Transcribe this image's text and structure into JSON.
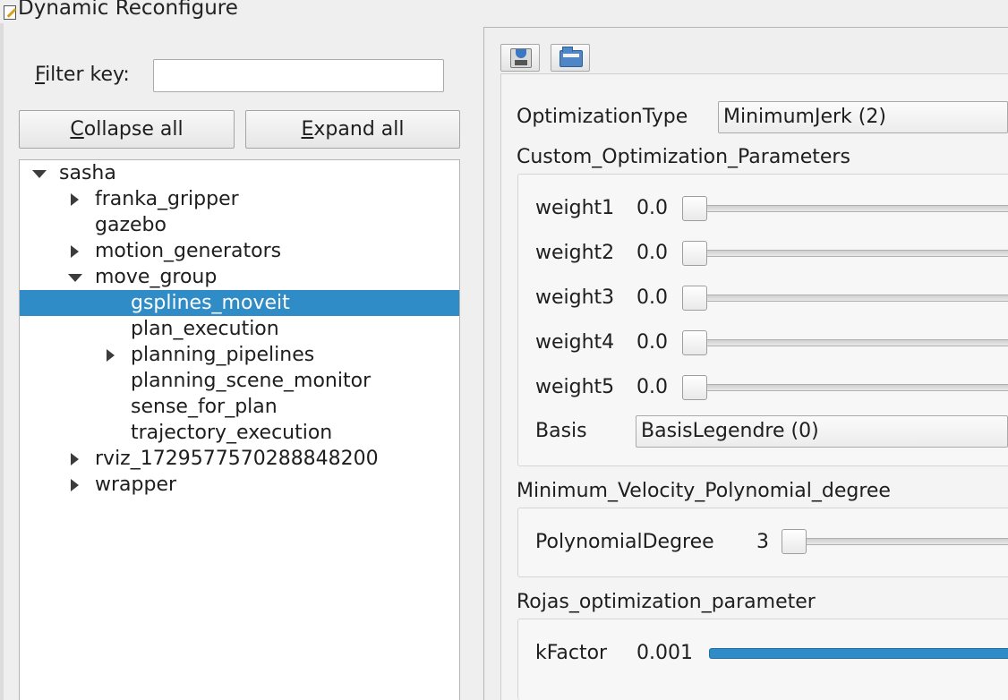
{
  "window": {
    "title": "Dynamic Reconfigure"
  },
  "filter": {
    "label": "Filter key:",
    "value": ""
  },
  "buttons": {
    "collapse_all": "Collapse all",
    "expand_all": "Expand all"
  },
  "tree": [
    {
      "label": "sasha",
      "expander": "expanded",
      "selected": false
    },
    {
      "label": "franka_gripper",
      "expander": "collapsed",
      "selected": false
    },
    {
      "label": "gazebo",
      "expander": "none",
      "selected": false
    },
    {
      "label": "motion_generators",
      "expander": "collapsed",
      "selected": false
    },
    {
      "label": "move_group",
      "expander": "expanded",
      "selected": false
    },
    {
      "label": "gsplines_moveit",
      "expander": "none",
      "selected": true
    },
    {
      "label": "plan_execution",
      "expander": "none",
      "selected": false
    },
    {
      "label": "planning_pipelines",
      "expander": "collapsed",
      "selected": false
    },
    {
      "label": "planning_scene_monitor",
      "expander": "none",
      "selected": false
    },
    {
      "label": "sense_for_plan",
      "expander": "none",
      "selected": false
    },
    {
      "label": "trajectory_execution",
      "expander": "none",
      "selected": false
    },
    {
      "label": "rviz_1729577570288848200",
      "expander": "collapsed",
      "selected": false
    },
    {
      "label": "wrapper",
      "expander": "collapsed",
      "selected": false
    }
  ],
  "toolbar": {
    "save_icon": "save-disk-icon",
    "open_icon": "open-folder-icon"
  },
  "params": {
    "optimization_type": {
      "label": "OptimizationType",
      "value": "MinimumJerk (2)"
    },
    "custom_group": {
      "title": "Custom_Optimization_Parameters",
      "weights": [
        {
          "label": "weight1",
          "value": "0.0",
          "level": 0
        },
        {
          "label": "weight2",
          "value": "0.0",
          "level": 0
        },
        {
          "label": "weight3",
          "value": "0.0",
          "level": 0
        },
        {
          "label": "weight4",
          "value": "0.0",
          "level": 0
        },
        {
          "label": "weight5",
          "value": "0.0",
          "level": 0
        }
      ],
      "basis": {
        "label": "Basis",
        "value": "BasisLegendre (0)"
      }
    },
    "min_velocity_group": {
      "title": "Minimum_Velocity_Polynomial_degree",
      "degree": {
        "label": "PolynomialDegree",
        "value": "3",
        "level": 0
      }
    },
    "rojas_group": {
      "title": "Rojas_optimization_parameter",
      "kfactor": {
        "label": "kFactor",
        "value": "0.001"
      }
    }
  },
  "colors": {
    "selection": "#308cc6",
    "slider_fill": "#308cc6"
  }
}
